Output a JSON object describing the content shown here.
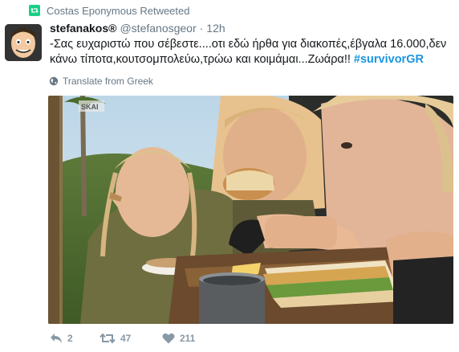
{
  "social_context": {
    "text": "Costas Eponymous Retweeted",
    "icon": "retweet-icon"
  },
  "tweet": {
    "display_name": "stefanakos®",
    "screen_name": "@stefanosgeor",
    "separator": "·",
    "time": "12h",
    "text_main": "-Σας ευχαριστώ που σέβεστε....οτι εδώ ήρθα για διακοπές,έβγαλα 16.000,δεν κάνω τίποτα,κουτσομπολεύω,τρώω και κοιμάμαι...Ζωάρα!! ",
    "hashtag": "#survivorGR",
    "translate_label": "Translate from Greek",
    "media_watermark": "SKAI"
  },
  "actions": {
    "reply_count": "2",
    "retweet_count": "47",
    "like_count": "211"
  },
  "colors": {
    "retweet_green": "#19cf86",
    "link_blue": "#1b95e0",
    "muted": "#657786"
  }
}
